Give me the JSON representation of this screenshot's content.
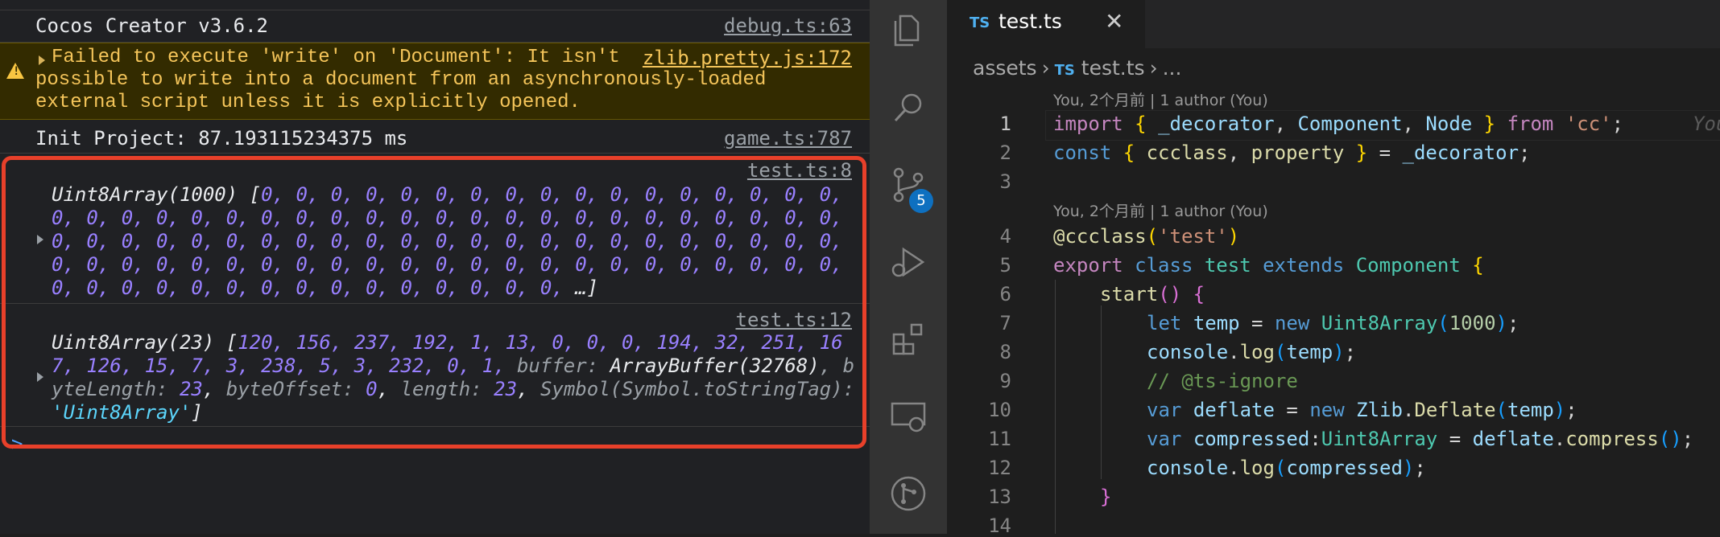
{
  "console": {
    "rows": [
      {
        "message": "Cocos Creator v3.6.2",
        "source": "debug.ts:63"
      },
      {
        "message_lines": [
          "Failed to execute 'write' on 'Document': It isn't",
          "possible to write into a document from an asynchronously-loaded",
          "external script unless it is explicitly opened."
        ],
        "source": "zlib.pretty.js:172",
        "level": "warning"
      },
      {
        "message": "Init Project: 87.193115234375 ms",
        "source": "game.ts:787"
      },
      {
        "source": "test.ts:8",
        "label": "Uint8Array(1000)",
        "lines": [
          "0, 0, 0, 0, 0, 0, 0, 0, 0, 0, 0, 0, 0, 0, 0, 0, 0,",
          "0, 0, 0, 0, 0, 0, 0, 0, 0, 0, 0, 0, 0, 0, 0, 0, 0, 0, 0, 0, 0, 0, 0,",
          "0, 0, 0, 0, 0, 0, 0, 0, 0, 0, 0, 0, 0, 0, 0, 0, 0, 0, 0, 0, 0, 0, 0,",
          "0, 0, 0, 0, 0, 0, 0, 0, 0, 0, 0, 0, 0, 0, 0, 0, 0, 0, 0, 0, 0, 0, 0,",
          "0, 0, 0, 0, 0, 0, 0, 0, 0, 0, 0, 0, 0, 0, 0,"
        ],
        "ellipsis": "…]"
      },
      {
        "source": "test.ts:12",
        "label": "Uint8Array(23)",
        "line1": "120, 156, 237, 192, 1, 13, 0, 0, 0, 194, 32, 251, 16",
        "line2_num": "7, 126, 15, 7, 3, 238, 5, 3, 232, 0, 1,",
        "buffer_key": "buffer:",
        "buffer_val": "ArrayBuffer(32768)",
        "line2_tail": ", b",
        "line3_key1": "yteLength:",
        "line3_val1": "23",
        "line3_key2": "byteOffset:",
        "line3_val2": "0",
        "line3_key3": "length:",
        "line3_val3": "23",
        "line3_key4": "Symbol(Symbol.toStringTag):",
        "line4_str": "'Uint8Array'",
        "line4_end": "]"
      }
    ],
    "prompt": ">"
  },
  "activity_bar": {
    "icons": [
      "explorer-icon",
      "search-icon",
      "source-control-icon",
      "run-debug-icon",
      "extensions-icon",
      "remote-explorer-icon",
      "git-graph-icon"
    ],
    "scm_badge": "5"
  },
  "editor": {
    "tab": {
      "badge": "TS",
      "label": "test.ts",
      "close": "✕"
    },
    "breadcrumb": {
      "folder": "assets",
      "badge": "TS",
      "file": "test.ts",
      "more": "..."
    },
    "codelens": [
      "You, 2个月前 | 1 author (You)",
      "You, 2个月前 | 1 author (You)"
    ],
    "ghost_blame": "You",
    "line_numbers": [
      "1",
      "2",
      "3",
      "4",
      "5",
      "6",
      "7",
      "8",
      "9",
      "10",
      "11",
      "12",
      "13",
      "14"
    ],
    "code": {
      "l1": {
        "import": "import",
        "ob": "{",
        "a": "_decorator",
        "b": "Component",
        "c": "Node",
        "cb": "}",
        "from": "from",
        "str": "'cc'",
        "semi": ";"
      },
      "l2": {
        "const": "const",
        "ob": "{",
        "a": "ccclass",
        "b": "property",
        "cb": "}",
        "eq": " = ",
        "c": "_decorator",
        "semi": ";"
      },
      "l4": {
        "dec": "@ccclass",
        "op": "(",
        "str": "'test'",
        "cp": ")"
      },
      "l5": {
        "export": "export",
        "class": "class",
        "name": "test",
        "extends": "extends",
        "base": "Component",
        "ob": "{"
      },
      "l6": {
        "fn": "start",
        "parens": "()",
        "ob": "{"
      },
      "l7": {
        "let": "let",
        "v": "temp",
        "eq": " = ",
        "new": "new",
        "ty": "Uint8Array",
        "op": "(",
        "num": "1000",
        "cp": ")",
        "semi": ";"
      },
      "l8": {
        "obj": "console",
        "dot": ".",
        "fn": "log",
        "op": "(",
        "arg": "temp",
        "cp": ")",
        "semi": ";"
      },
      "l9": {
        "comment": "// @ts-ignore"
      },
      "l10": {
        "var": "var",
        "v": "deflate",
        "eq": " = ",
        "new": "new",
        "ns": "Zlib",
        "dot": ".",
        "cls": "Deflate",
        "op": "(",
        "arg": "temp",
        "cp": ")",
        "semi": ";"
      },
      "l11": {
        "var": "var",
        "v": "compressed",
        "colon": ":",
        "ty": "Uint8Array",
        "eq": " = ",
        "obj": "deflate",
        "dot": ".",
        "fn": "compress",
        "parens": "()",
        "semi": ";"
      },
      "l12": {
        "obj": "console",
        "dot": ".",
        "fn": "log",
        "op": "(",
        "arg": "compressed",
        "cp": ")",
        "semi": ";"
      },
      "l13": {
        "cb": "}"
      }
    }
  }
}
